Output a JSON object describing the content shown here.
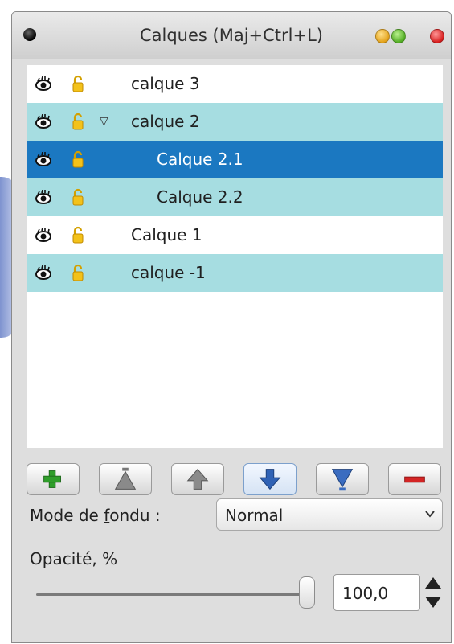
{
  "window": {
    "title": "Calques (Maj+Ctrl+L)"
  },
  "layers": [
    {
      "name": "calque 3",
      "indent": 0,
      "state": "normal",
      "expander": ""
    },
    {
      "name": "calque 2",
      "indent": 0,
      "state": "alt",
      "expander": "▽"
    },
    {
      "name": "Calque 2.1",
      "indent": 1,
      "state": "selected",
      "expander": ""
    },
    {
      "name": "Calque 2.2",
      "indent": 1,
      "state": "alt",
      "expander": ""
    },
    {
      "name": "Calque 1",
      "indent": 0,
      "state": "normal",
      "expander": ""
    },
    {
      "name": "calque -1",
      "indent": 0,
      "state": "alt",
      "expander": ""
    }
  ],
  "toolbar": {
    "buttons": [
      {
        "name": "add-layer-button",
        "icon": "plus-icon"
      },
      {
        "name": "raise-to-top-button",
        "icon": "raise-top-icon"
      },
      {
        "name": "raise-layer-button",
        "icon": "arrow-up-icon"
      },
      {
        "name": "lower-layer-button",
        "icon": "arrow-down-icon"
      },
      {
        "name": "lower-to-bottom-button",
        "icon": "lower-bottom-icon"
      },
      {
        "name": "delete-layer-button",
        "icon": "minus-icon"
      }
    ]
  },
  "blend": {
    "label_pre": "Mode de ",
    "label_underlined": "f",
    "label_post": "ondu :",
    "value": "Normal"
  },
  "opacity": {
    "label": "Opacité, %",
    "value": "100,0",
    "level_percent": 100
  },
  "colors": {
    "alt_row": "#a6dde1",
    "selected_row": "#1b78c1"
  }
}
